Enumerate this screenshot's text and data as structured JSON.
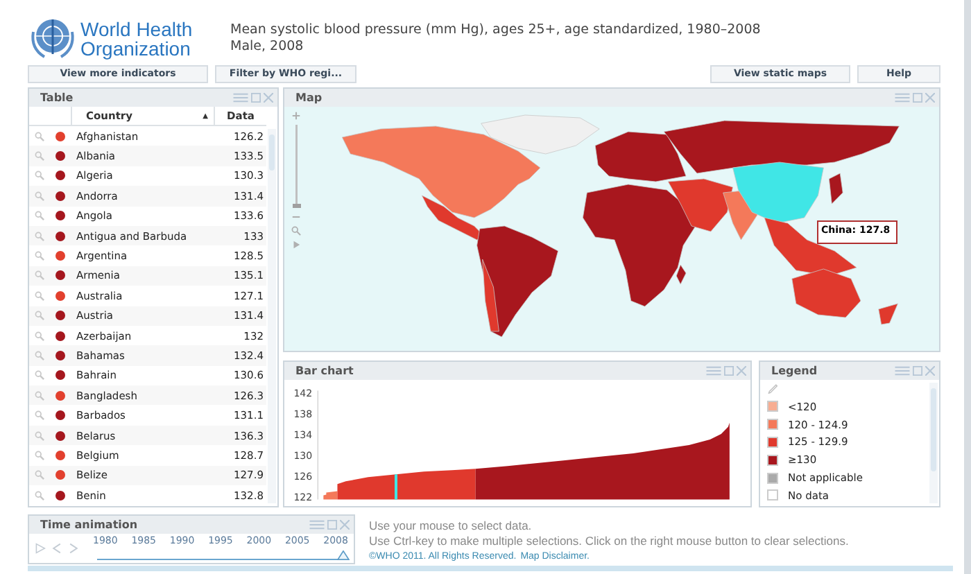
{
  "header": {
    "logo_lines": [
      "World Health",
      "Organization"
    ],
    "title_lines": [
      "Mean systolic blood pressure (mm Hg), ages 25+, age standardized, 1980–2008",
      "Male, 2008"
    ]
  },
  "toolbar": {
    "left_buttons": [
      "View more indicators",
      "Filter by WHO regi..."
    ],
    "right_buttons": [
      "View static maps",
      "Help"
    ]
  },
  "table": {
    "title": "Table",
    "columns": [
      "Country",
      "Data"
    ],
    "sort_indicator": "▲",
    "rows": [
      {
        "country": "Afghanistan",
        "value": "126.2",
        "color": "#e2402e"
      },
      {
        "country": "Albania",
        "value": "133.5",
        "color": "#a5171e"
      },
      {
        "country": "Algeria",
        "value": "130.3",
        "color": "#a5171e"
      },
      {
        "country": "Andorra",
        "value": "131.4",
        "color": "#a5171e"
      },
      {
        "country": "Angola",
        "value": "133.6",
        "color": "#a5171e"
      },
      {
        "country": "Antigua and Barbuda",
        "value": "133",
        "color": "#a5171e"
      },
      {
        "country": "Argentina",
        "value": "128.5",
        "color": "#e2402e"
      },
      {
        "country": "Armenia",
        "value": "135.1",
        "color": "#a5171e"
      },
      {
        "country": "Australia",
        "value": "127.1",
        "color": "#e2402e"
      },
      {
        "country": "Austria",
        "value": "131.4",
        "color": "#a5171e"
      },
      {
        "country": "Azerbaijan",
        "value": "132",
        "color": "#a5171e"
      },
      {
        "country": "Bahamas",
        "value": "132.4",
        "color": "#a5171e"
      },
      {
        "country": "Bahrain",
        "value": "130.6",
        "color": "#a5171e"
      },
      {
        "country": "Bangladesh",
        "value": "126.3",
        "color": "#e2402e"
      },
      {
        "country": "Barbados",
        "value": "131.1",
        "color": "#a5171e"
      },
      {
        "country": "Belarus",
        "value": "136.3",
        "color": "#a5171e"
      },
      {
        "country": "Belgium",
        "value": "128.7",
        "color": "#e2402e"
      },
      {
        "country": "Belize",
        "value": "127.9",
        "color": "#e2402e"
      },
      {
        "country": "Benin",
        "value": "132.8",
        "color": "#a5171e"
      }
    ]
  },
  "map": {
    "title": "Map",
    "tooltip": "China: 127.8"
  },
  "map_zoom": {
    "level": 0
  },
  "bar_chart": {
    "title": "Bar chart",
    "y_axis_labels": [
      "142",
      "138",
      "134",
      "130",
      "126",
      "122"
    ]
  },
  "legend": {
    "title": "Legend",
    "items": [
      {
        "label": "<120",
        "color": "#f7ad92"
      },
      {
        "label": "120 - 124.9",
        "color": "#f4795a"
      },
      {
        "label": "125 - 129.9",
        "color": "#e0392d"
      },
      {
        "label": "≥130",
        "color": "#a8171e"
      },
      {
        "label": "Not applicable",
        "color": "#aaaaaa"
      },
      {
        "label": "No data",
        "color": "#ffffff"
      }
    ]
  },
  "time_animation": {
    "title": "Time animation",
    "years": [
      "1980",
      "1985",
      "1990",
      "1995",
      "2000",
      "2005",
      "2008"
    ],
    "slider": {
      "level": 1
    }
  },
  "footer": {
    "lines": [
      "Use your mouse to select data.",
      "Use Ctrl-key to make multiple selections.  Click on the right mouse button to clear selections."
    ],
    "copyright": "©WHO 2011. All Rights Reserved.",
    "disclaimer_link": "Map Disclaimer."
  }
}
